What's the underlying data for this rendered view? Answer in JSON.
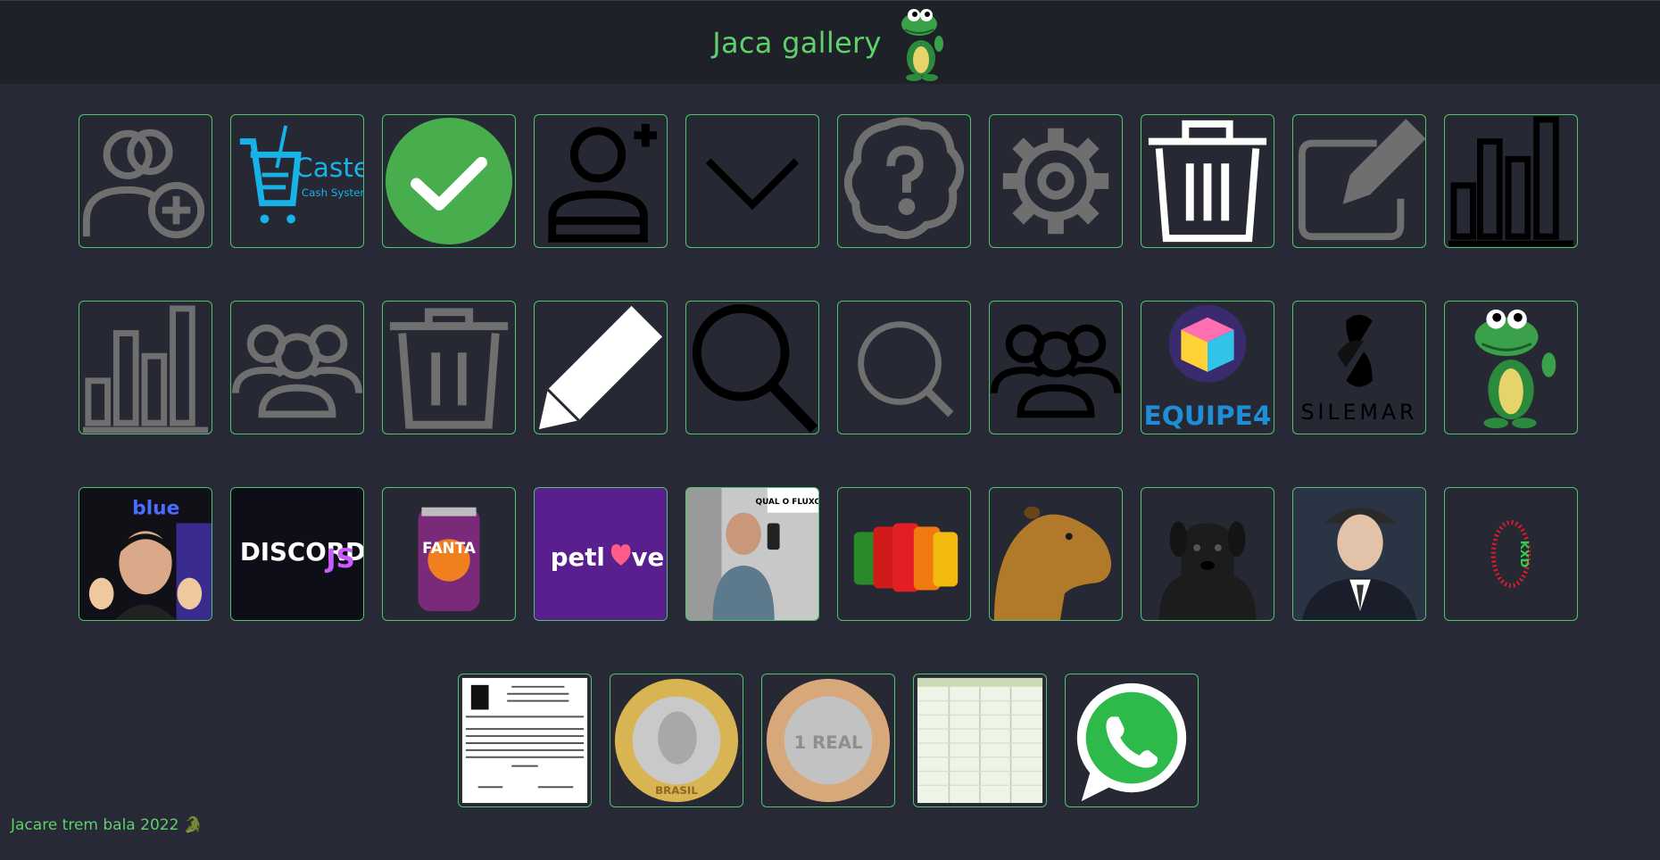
{
  "header": {
    "title": "Jaca gallery",
    "mascot_icon": "crocodile-mascot-icon"
  },
  "footer": {
    "text": "Jacare trem bala 2022 🐊"
  },
  "colors": {
    "accent": "#5ed16a",
    "tile_border": "#4fc46a",
    "background": "#272936",
    "header_bg": "#1f2128"
  },
  "gallery": {
    "rows": [
      [
        "add-users-icon",
        "castem-logo",
        "check-circle-icon",
        "add-user-icon",
        "chevron-down-icon",
        "help-brain-icon",
        "gear-icon",
        "trash-white-icon",
        "edit-square-icon",
        "bar-chart-black-icon"
      ],
      [
        "bar-chart-gray-icon",
        "users-gray-icon",
        "trash-gray-icon",
        "pencil-white-icon",
        "search-black-icon",
        "search-gray-icon",
        "users-black-icon",
        "equipe4-logo",
        "silemar-logo",
        "crocodile-mascot-image"
      ],
      [
        "blue-streamer-photo",
        "discordjs-logo",
        "fanta-can-photo",
        "petlove-logo",
        "selfie-photo",
        "soda-cans-photo",
        "capybara-photo",
        "black-dog-photo",
        "portrait-photo",
        "kxd-badge"
      ],
      [
        "receipt-document",
        "coin-brasil-photo",
        "coin-real-photo",
        "spreadsheet-document",
        "whatsapp-logo"
      ]
    ],
    "labels": {
      "castem_brand": "Castem",
      "castem_sub": "Cash System",
      "equipe4": "EQUIPE4",
      "silemar": "SILEMAR",
      "blue": "blue",
      "discord": "DISCORD",
      "discord_js": "JS",
      "fanta": "FANTA",
      "petlove_a": "petl",
      "petlove_b": "ve",
      "selfie_bubble": "QUAL O FLUXO??",
      "kxd": "KXD",
      "coin_brasil": "BRASIL",
      "coin_real": "1 REAL"
    }
  }
}
